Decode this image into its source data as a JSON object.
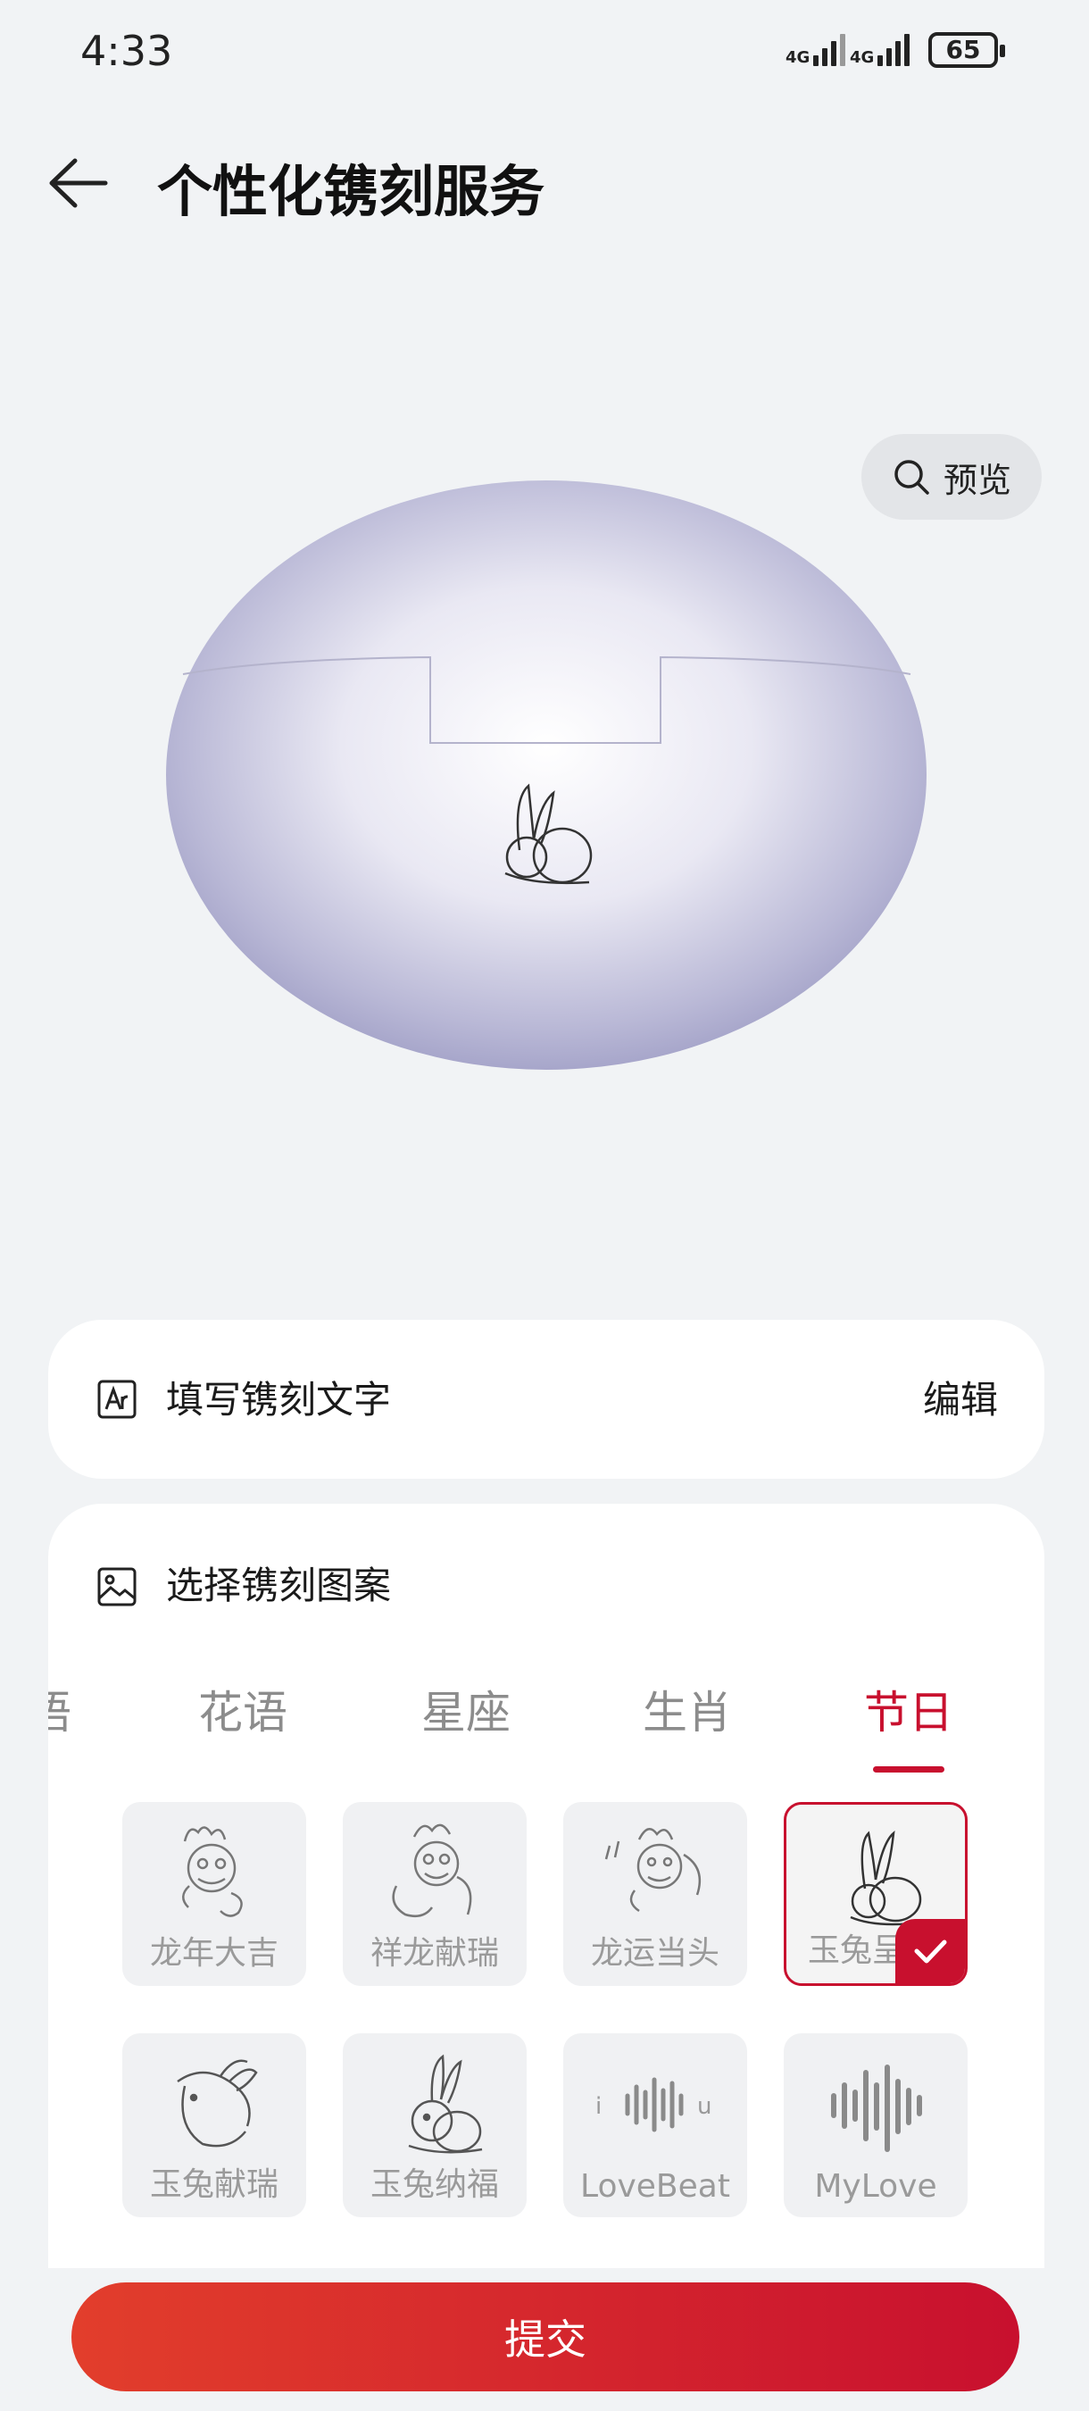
{
  "status_bar": {
    "time": "4:33",
    "net1": "4G",
    "net2": "4G",
    "battery": "65"
  },
  "header": {
    "title": "个性化镌刻服务"
  },
  "preview": {
    "label": "预览"
  },
  "text_row": {
    "label": "填写镌刻文字",
    "action": "编辑"
  },
  "pattern_row": {
    "label": "选择镌刻图案"
  },
  "tabs": [
    {
      "label": "语",
      "active": false
    },
    {
      "label": "花语",
      "active": false
    },
    {
      "label": "星座",
      "active": false
    },
    {
      "label": "生肖",
      "active": false
    },
    {
      "label": "节日",
      "active": true
    }
  ],
  "patterns": [
    {
      "label": "龙年大吉",
      "icon": "dragon-icon",
      "selected": false
    },
    {
      "label": "祥龙献瑞",
      "icon": "dragon-icon",
      "selected": false
    },
    {
      "label": "龙运当头",
      "icon": "dragon-icon",
      "selected": false
    },
    {
      "label": "玉兔呈",
      "icon": "rabbit-icon",
      "selected": true
    },
    {
      "label": "玉兔献瑞",
      "icon": "rabbit-icon",
      "selected": false
    },
    {
      "label": "玉兔纳福",
      "icon": "rabbit-icon",
      "selected": false
    },
    {
      "label": "LoveBeat",
      "icon": "soundwave-icon",
      "selected": false
    },
    {
      "label": "MyLove",
      "icon": "soundwave-icon",
      "selected": false
    }
  ],
  "submit": {
    "label": "提交"
  },
  "colors": {
    "accent": "#c8102e",
    "background": "#f1f3f5",
    "case": "#cfd0e6"
  }
}
